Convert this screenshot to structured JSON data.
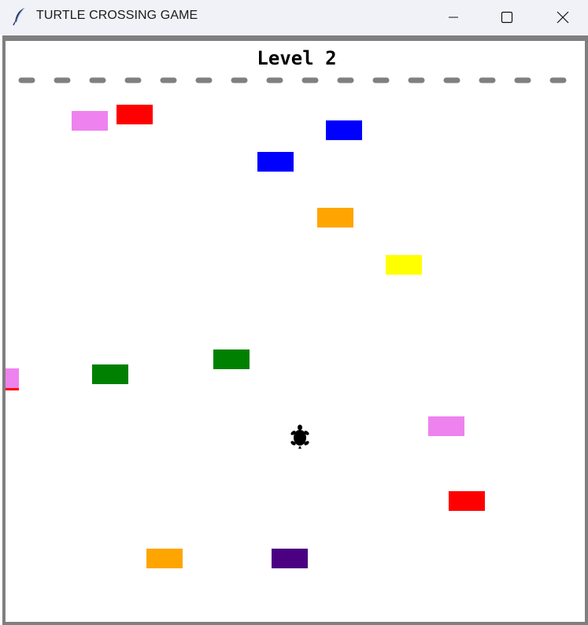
{
  "window": {
    "title": "TURTLE CROSSING GAME",
    "icon": "feather-icon",
    "controls": [
      "minimize-icon",
      "maximize-icon",
      "close-icon"
    ]
  },
  "game": {
    "level_text": "Level 2",
    "finish_line": {
      "style": "dashed",
      "color": "#808080"
    },
    "player": {
      "icon": "turtle-icon",
      "color": "#000000"
    },
    "cars": [
      {
        "color": "#ee82ee"
      },
      {
        "color": "#ff0000"
      },
      {
        "color": "#0000ff"
      },
      {
        "color": "#0000ff"
      },
      {
        "color": "#ffa500"
      },
      {
        "color": "#ffff00"
      },
      {
        "color": "#ee82ee"
      },
      {
        "color": "#ff0000"
      },
      {
        "color": "#008000"
      },
      {
        "color": "#008000"
      },
      {
        "color": "#ee82ee"
      },
      {
        "color": "#ff0000"
      },
      {
        "color": "#ffa500"
      },
      {
        "color": "#4b0082"
      }
    ]
  }
}
